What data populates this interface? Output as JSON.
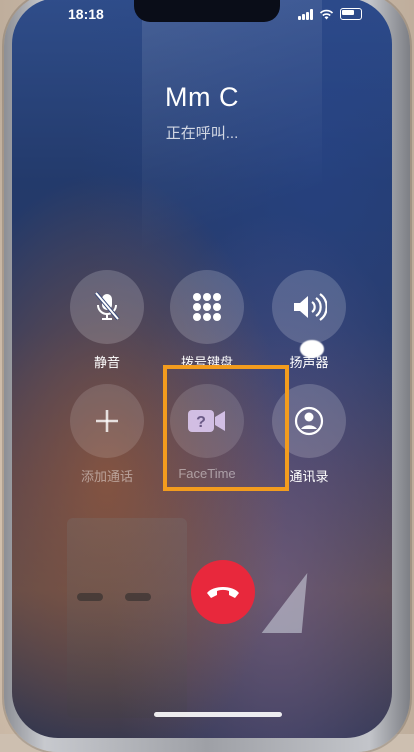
{
  "status_bar": {
    "time": "18:18"
  },
  "call": {
    "contact_name": "Mm C",
    "status": "正在呼叫..."
  },
  "controls": {
    "mute_label": "静音",
    "keypad_label": "拨号键盘",
    "speaker_label": "扬声器",
    "add_call_label": "添加通话",
    "facetime_label": "FaceTime",
    "contacts_label": "通讯录"
  },
  "icons": {
    "mute": "mic-slash-icon",
    "keypad": "keypad-grid-icon",
    "speaker": "speaker-wave-icon",
    "add_call": "plus-icon",
    "facetime": "video-camera-question-icon",
    "contacts": "person-circle-icon",
    "end_call": "phone-hangup-icon"
  },
  "colors": {
    "end_call": "#e8283c",
    "highlight": "#f39c1e"
  },
  "highlighted_control": "facetime"
}
